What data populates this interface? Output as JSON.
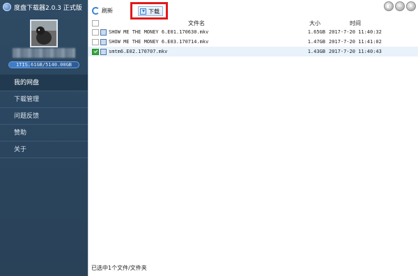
{
  "app": {
    "title": "度盘下载器2.0.3 正式版"
  },
  "sidebar": {
    "quota_text": "1TIS.61GB/5140.00GB",
    "quota_fraction": 0.3,
    "nav": [
      {
        "label": "我的网盘",
        "active": true
      },
      {
        "label": "下载管理",
        "active": false
      },
      {
        "label": "问题反馈",
        "active": false
      },
      {
        "label": "赞助",
        "active": false
      },
      {
        "label": "关于",
        "active": false
      }
    ]
  },
  "toolbar": {
    "refresh_label": "刷新",
    "download_label": "下载"
  },
  "table": {
    "headers": {
      "name": "文件名",
      "size": "大小",
      "time": "时间"
    },
    "rows": [
      {
        "name": "SHOW ME THE MONEY 6.E01.170630.mkv",
        "size": "1.65GB",
        "time": "2017-7-20 11:40:32",
        "checked": false
      },
      {
        "name": "SHOW ME THE MONEY 6.E03.170714.mkv",
        "size": "1.47GB",
        "time": "2017-7-20 11:41:02",
        "checked": false
      },
      {
        "name": "smtm6.E02.170707.mkv",
        "size": "1.43GB",
        "time": "2017-7-20 11:40:43",
        "checked": true
      }
    ]
  },
  "status": {
    "text": "已选中1个文件/文件夹"
  },
  "colors": {
    "sidebar_bg": "#2d4860",
    "highlight_border": "#e01a1a",
    "selected_row": "#e8f2fb",
    "check_green": "#36a53b"
  }
}
